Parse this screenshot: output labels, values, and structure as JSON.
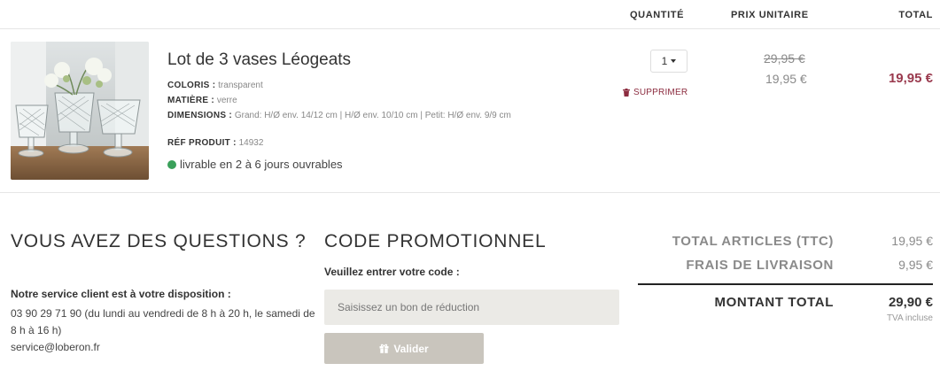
{
  "table_headers": {
    "quantity": "QUANTITÉ",
    "unit_price": "PRIX UNITAIRE",
    "total": "TOTAL"
  },
  "product": {
    "name": "Lot de 3 vases Léogeats",
    "colour_label": "COLORIS :",
    "colour_value": "transparent",
    "material_label": "MATIÈRE :",
    "material_value": "verre",
    "dimensions_label": "DIMENSIONS :",
    "dimensions_value": "Grand: H/Ø env. 14/12 cm | H/Ø env. 10/10 cm | Petit: H/Ø env. 9/9 cm",
    "ref_label": "RÉF PRODUIT :",
    "ref_value": "14932",
    "availability": "livrable en 2 à 6 jours ouvrables",
    "availability_color": "#3aa05a",
    "quantity": "1",
    "remove_label": "SUPPRIMER",
    "old_price": "29,95 €",
    "unit_price": "19,95 €",
    "line_total": "19,95 €",
    "price_color": "#9a3a4e"
  },
  "questions": {
    "title": "VOUS AVEZ DES QUESTIONS ?",
    "service_label": "Notre service client est à votre disposition :",
    "service_text": "03 90 29 71 90 (du lundi au vendredi de 8 h à 20 h, le samedi de 8 h à 16 h)",
    "email": "service@loberon.fr"
  },
  "promo": {
    "title": "CODE PROMOTIONNEL",
    "label": "Veuillez entrer votre code :",
    "placeholder": "Saisissez un bon de réduction",
    "button_label": "Valider",
    "button_icon": "gift-icon"
  },
  "summary": {
    "articles_label": "TOTAL ARTICLES (TTC)",
    "articles_value": "19,95 €",
    "shipping_label": "FRAIS DE LIVRAISON",
    "shipping_value": "9,95 €",
    "total_label": "MONTANT TOTAL",
    "total_value": "29,90 €",
    "tax_note": "TVA incluse"
  }
}
